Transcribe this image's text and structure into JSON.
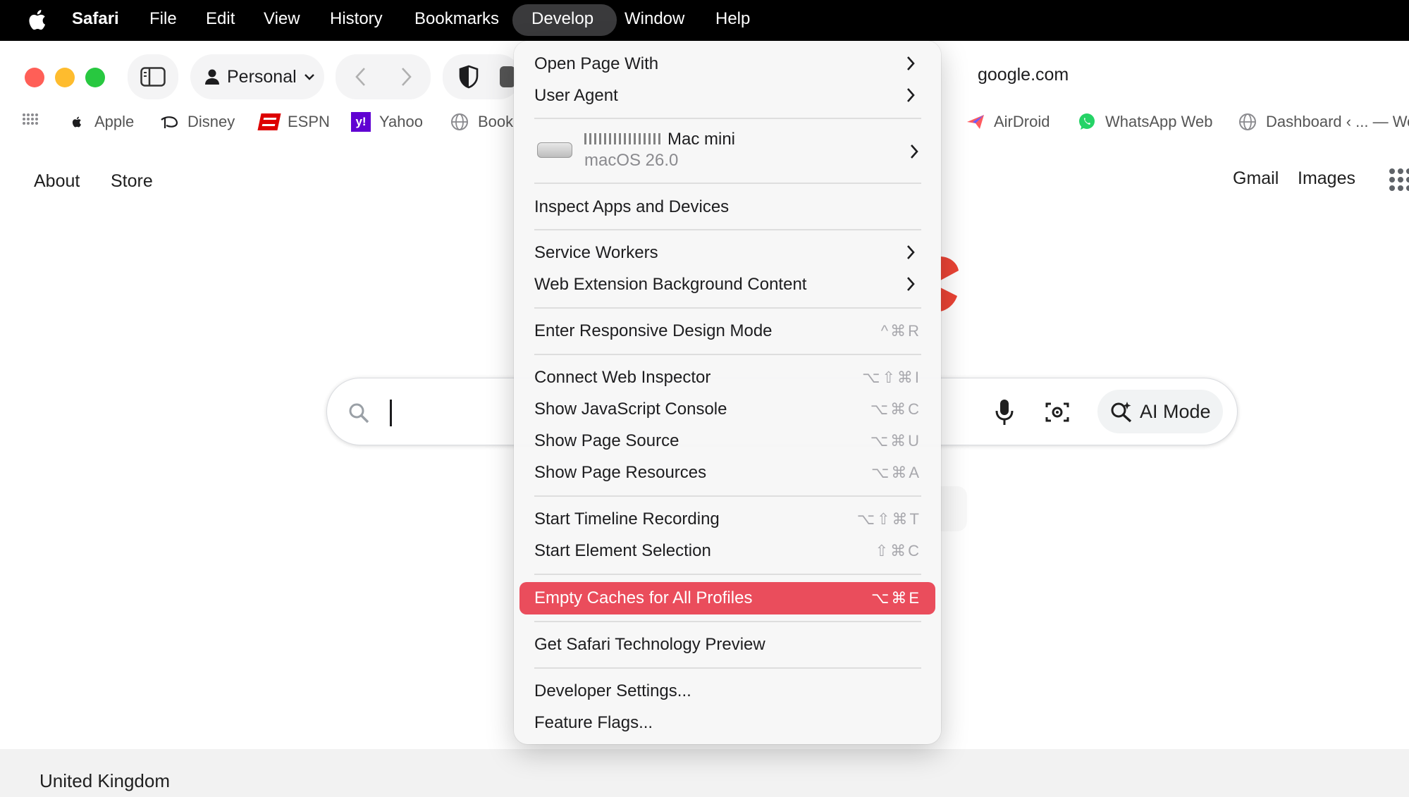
{
  "menubar": {
    "app": "Safari",
    "items": [
      "File",
      "Edit",
      "View",
      "History",
      "Bookmarks",
      "Develop",
      "Window",
      "Help"
    ]
  },
  "toolbar": {
    "profile": "Personal",
    "address": "google.com"
  },
  "bookmarks": {
    "left": [
      {
        "label": "Apple",
        "icon": "apple-icon"
      },
      {
        "label": "Disney",
        "icon": "disney-icon"
      },
      {
        "label": "ESPN",
        "icon": "espn-icon"
      },
      {
        "label": "Yahoo",
        "icon": "yahoo-icon"
      },
      {
        "label": "Book",
        "icon": "globe-icon"
      }
    ],
    "right": [
      {
        "label": "AirDroid",
        "icon": "airdroid-icon"
      },
      {
        "label": "WhatsApp Web",
        "icon": "whatsapp-icon"
      },
      {
        "label": "Dashboard ‹ ... — Wo",
        "icon": "globe-icon"
      }
    ]
  },
  "page": {
    "top_left_links": [
      "About",
      "Store"
    ],
    "top_right_links": [
      "Gmail",
      "Images"
    ],
    "ai_mode": "AI Mode",
    "footer_country": "United Kingdom"
  },
  "develop_menu": {
    "open_page_with": "Open Page With",
    "user_agent": "User Agent",
    "device_name": "Mac mini",
    "device_os": "macOS 26.0",
    "inspect_apps": "Inspect Apps and Devices",
    "service_workers": "Service Workers",
    "web_extension_bg": "Web Extension Background Content",
    "responsive_mode": {
      "label": "Enter Responsive Design Mode",
      "shortcut": "^⌘R"
    },
    "connect_inspector": {
      "label": "Connect Web Inspector",
      "shortcut": "⌥⇧⌘I"
    },
    "js_console": {
      "label": "Show JavaScript Console",
      "shortcut": "⌥⌘C"
    },
    "page_source": {
      "label": "Show Page Source",
      "shortcut": "⌥⌘U"
    },
    "page_resources": {
      "label": "Show Page Resources",
      "shortcut": "⌥⌘A"
    },
    "timeline": {
      "label": "Start Timeline Recording",
      "shortcut": "⌥⇧⌘T"
    },
    "element_selection": {
      "label": "Start Element Selection",
      "shortcut": "⇧⌘C"
    },
    "empty_caches": {
      "label": "Empty Caches for All Profiles",
      "shortcut": "⌥⌘E"
    },
    "tech_preview": "Get Safari Technology Preview",
    "developer_settings": "Developer Settings...",
    "feature_flags": "Feature Flags..."
  },
  "colors": {
    "menu_highlight": "#ea4d5c",
    "close": "#ff5f57",
    "minimize": "#febc2e",
    "zoom": "#28c840"
  }
}
